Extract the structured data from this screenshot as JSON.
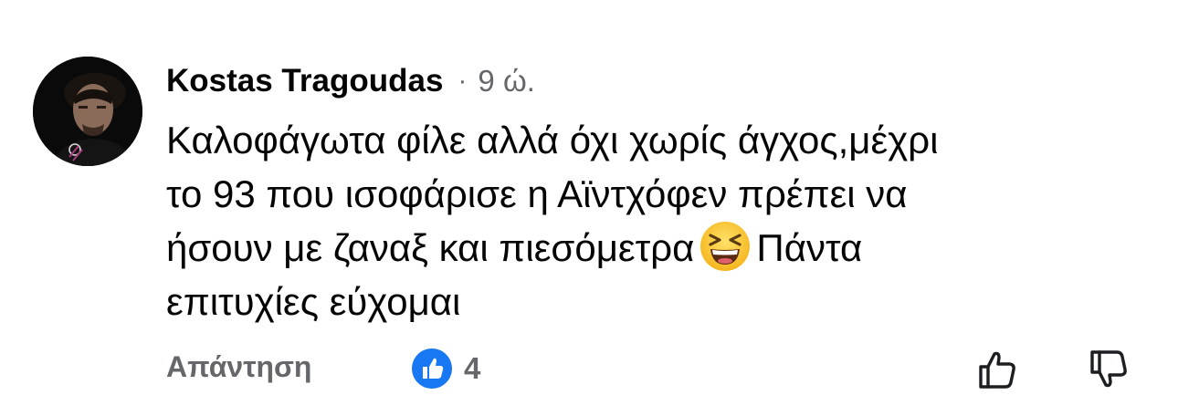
{
  "comment": {
    "author": "Kostas Tragoudas",
    "separator": "·",
    "time": "9 ώ.",
    "lines": [
      "Καλοφάγωτα φίλε αλλά όχι χωρίς άγχος,μέχρι",
      "το 93 που ισοφάρισε η Αϊντχόφεν πρέπει να",
      "ήσουν με ζαναξ και πιεσόμετρα",
      "Πάντα",
      "επιτυχίες εύχομαι"
    ],
    "emoji": "laughing-squinting-face-emoji"
  },
  "actions": {
    "reply_label": "Απάντηση",
    "like_count": "4",
    "like_badge_color": "#1877f2",
    "upvote_icon": "thumbs-up-outline-icon",
    "downvote_icon": "thumbs-down-outline-icon"
  }
}
